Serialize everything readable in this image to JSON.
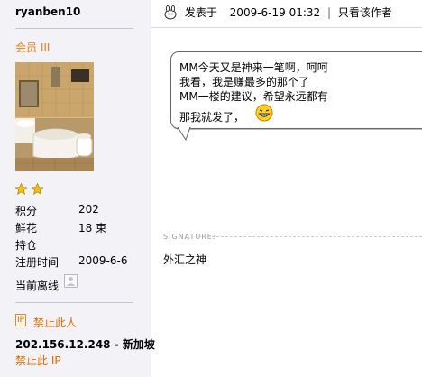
{
  "user": {
    "username": "ryanben10",
    "rank": "会员 III",
    "stats": [
      {
        "label": "积分",
        "value": "202"
      },
      {
        "label": "鲜花",
        "value": "18 束"
      },
      {
        "label": "持仓",
        "value": ""
      },
      {
        "label": "注册时间",
        "value": "2009-6-6"
      }
    ],
    "online_status": "当前离线",
    "ban_user": "禁止此人",
    "ip_location": "202.156.12.248 - 新加坡",
    "ban_ip": "禁止此 IP"
  },
  "post": {
    "posted_label": "发表于",
    "datetime": "2009-6-19 01:32",
    "separator": "|",
    "author_only": "只看该作者",
    "lines": [
      "MM今天又是神来一笔啊，呵呵",
      "我看，我是赚最多的那个了",
      "MM一楼的建议，希望永远都有",
      "那我就发了，"
    ],
    "signature_label": "SIGNATURE:",
    "signature_text": "外汇之神"
  },
  "colors": {
    "accent_orange": "#e06a00",
    "sidebar_bg": "#f2f2f7",
    "star": "#f2c21a"
  },
  "icons": [
    "post-icon",
    "star-icon",
    "offline-icon",
    "ip-icon",
    "grin-emoticon-icon"
  ]
}
